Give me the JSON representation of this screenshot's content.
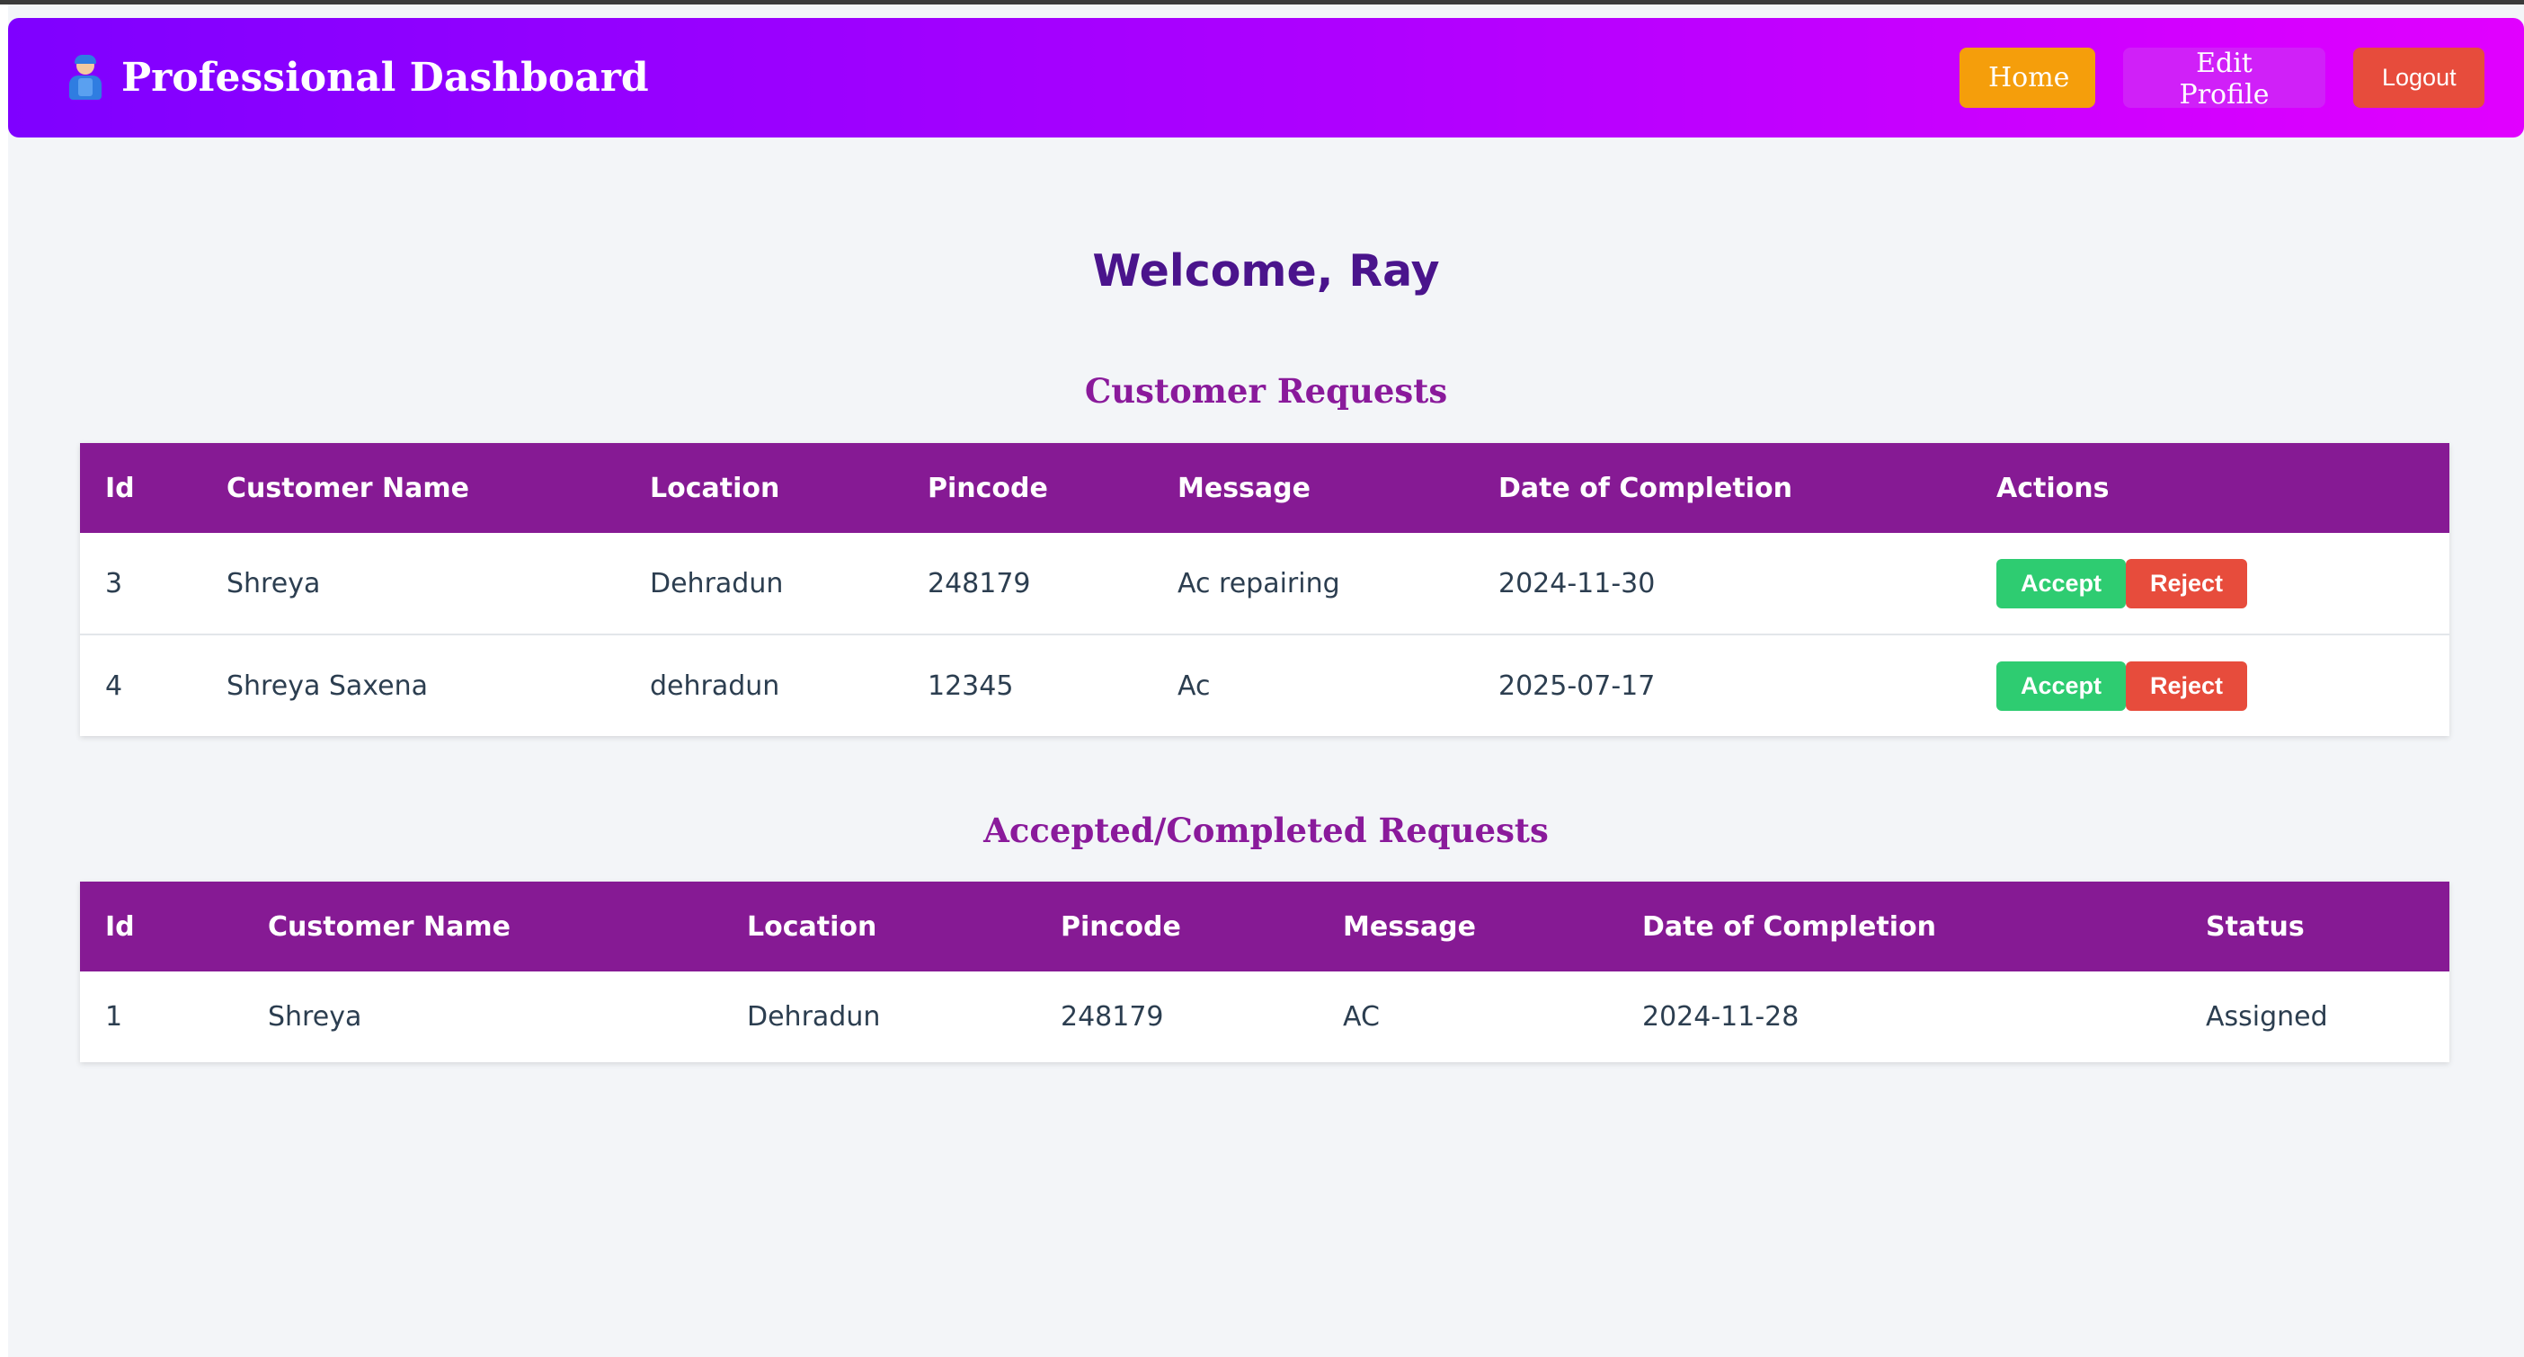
{
  "navbar": {
    "brand_icon": "mechanic-icon",
    "title": "Professional Dashboard",
    "home_label": "Home",
    "edit_profile_label": "Edit Profile",
    "logout_label": "Logout"
  },
  "welcome": "Welcome, Ray",
  "customer_requests": {
    "title": "Customer Requests",
    "headers": [
      "Id",
      "Customer Name",
      "Location",
      "Pincode",
      "Message",
      "Date of Completion",
      "Actions"
    ],
    "rows": [
      {
        "id": "3",
        "name": "Shreya",
        "location": "Dehradun",
        "pincode": "248179",
        "message": "Ac repairing",
        "date": "2024-11-30"
      },
      {
        "id": "4",
        "name": "Shreya Saxena",
        "location": "dehradun",
        "pincode": "12345",
        "message": "Ac",
        "date": "2025-07-17"
      }
    ],
    "accept_label": "Accept",
    "reject_label": "Reject"
  },
  "accepted_requests": {
    "title": "Accepted/Completed Requests",
    "headers": [
      "Id",
      "Customer Name",
      "Location",
      "Pincode",
      "Message",
      "Date of Completion",
      "Status"
    ],
    "rows": [
      {
        "id": "1",
        "name": "Shreya",
        "location": "Dehradun",
        "pincode": "248179",
        "message": "AC",
        "date": "2024-11-28",
        "status": "Assigned"
      }
    ]
  },
  "colors": {
    "navbar_gradient": [
      "#7f00ff",
      "#e100ff"
    ],
    "header_row": "#861a94",
    "accept": "#2ecc71",
    "reject": "#e74c3c",
    "home": "#f59e0b"
  }
}
